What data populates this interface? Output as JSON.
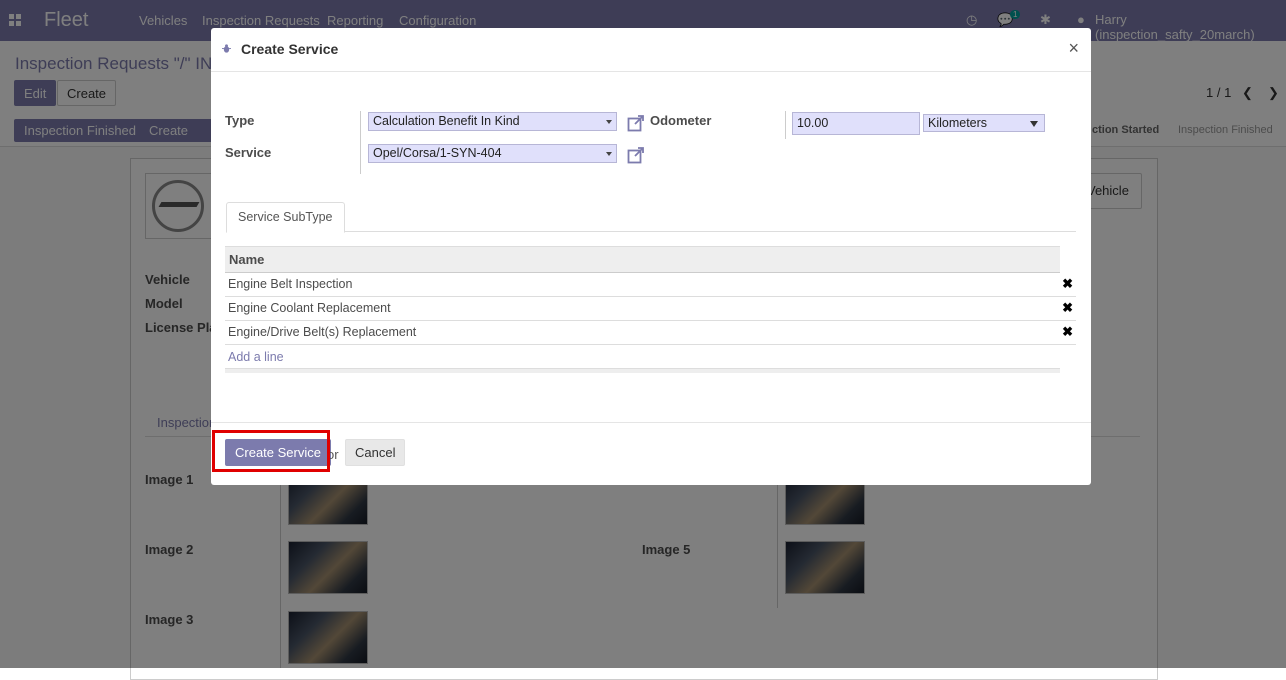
{
  "app": {
    "name": "Fleet",
    "menu": [
      "Vehicles",
      "Inspection Requests",
      "Reporting",
      "Configuration"
    ],
    "messages_badge": "1",
    "user": "Harry (inspection_safty_20march)"
  },
  "breadcrumb": "Inspection Requests \"/\" INS",
  "toolbar": {
    "edit": "Edit",
    "create": "Create"
  },
  "pager": "1 / 1",
  "header_buttons": {
    "inspection_finished": "Inspection Finished",
    "create_service": "Create Serv"
  },
  "statusbar": {
    "started": "ction Started",
    "finished": "Inspection Finished"
  },
  "sheet": {
    "vehicle_button": "Vehicle",
    "labels": {
      "vehicle": "Vehicle",
      "model": "Model",
      "license_plate": "License Pla"
    },
    "tab": "Inspection",
    "images": [
      "Image 1",
      "Image 2",
      "Image 3",
      "Image 5"
    ]
  },
  "modal": {
    "title": "Create Service",
    "close": "×",
    "type_label": "Type",
    "type_value": "Calculation Benefit In Kind",
    "service_label": "Service",
    "service_value": "Opel/Corsa/1-SYN-404",
    "odometer_label": "Odometer",
    "odometer_value": "10.00",
    "odometer_unit": "Kilometers",
    "tab": "Service SubType",
    "column_name": "Name",
    "rows": [
      "Engine Belt Inspection",
      "Engine Coolant Replacement",
      "Engine/Drive Belt(s) Replacement"
    ],
    "delete_glyph": "✖",
    "add_line": "Add a line",
    "submit": "Create Service",
    "or": "or",
    "cancel": "Cancel"
  }
}
